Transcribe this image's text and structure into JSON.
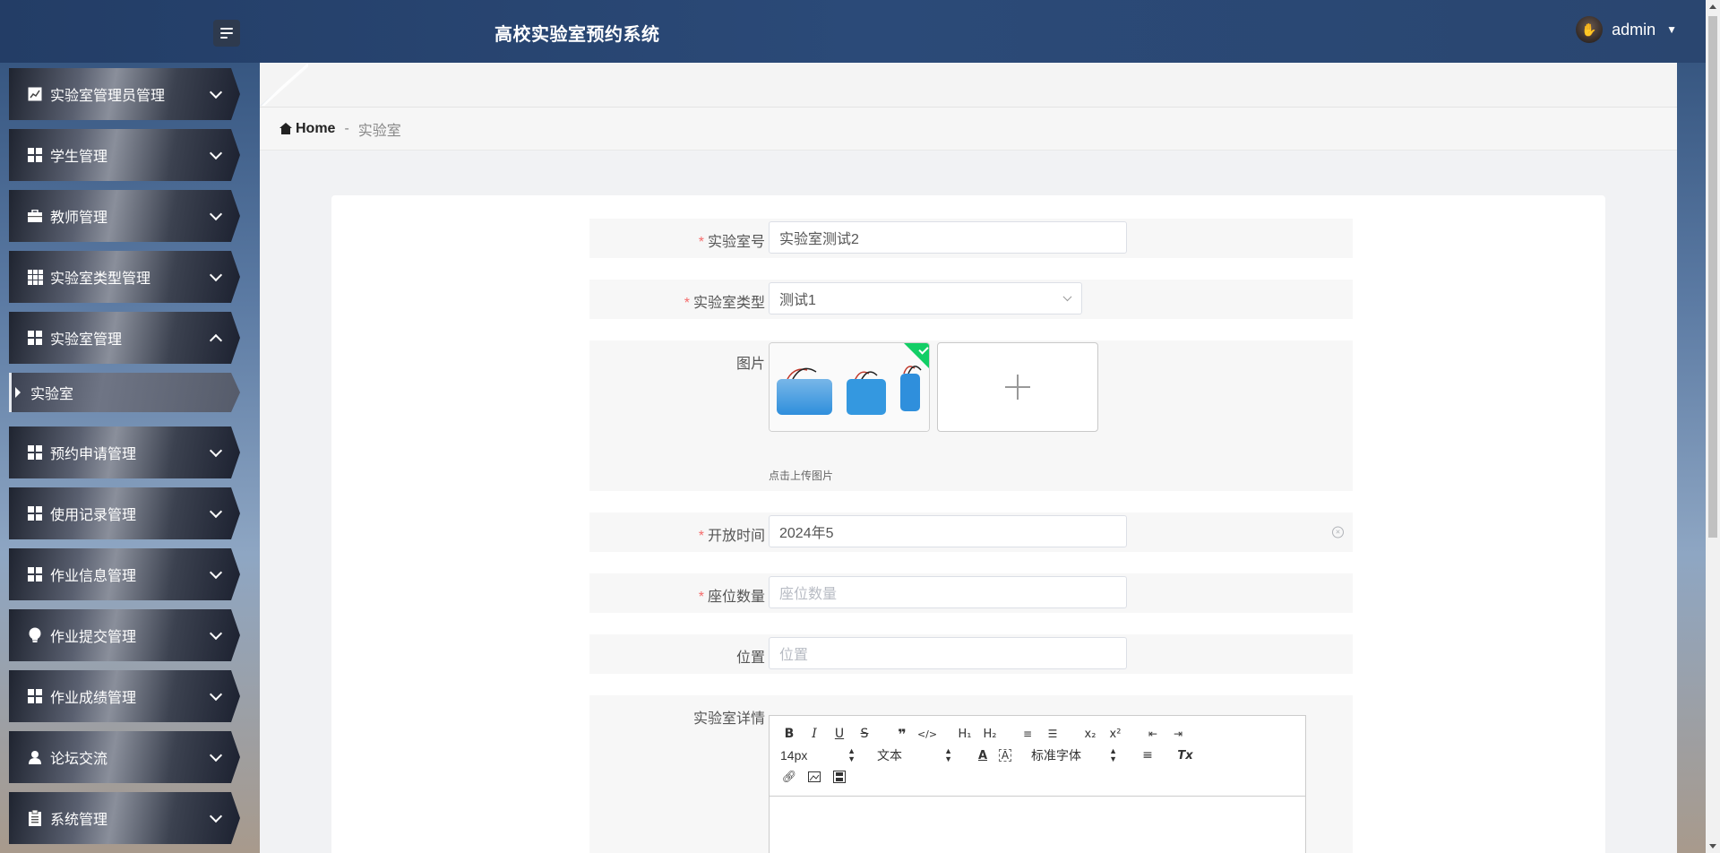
{
  "header": {
    "title": "高校实验室预约系统",
    "username": "admin"
  },
  "sidebar": {
    "items": [
      {
        "label": "实验室管理员管理",
        "icon": "chart-line-icon"
      },
      {
        "label": "学生管理",
        "icon": "grid-icon"
      },
      {
        "label": "教师管理",
        "icon": "briefcase-icon"
      },
      {
        "label": "实验室类型管理",
        "icon": "grid9-icon"
      },
      {
        "label": "实验室管理",
        "icon": "grid-icon",
        "expanded": true
      },
      {
        "label": "预约申请管理",
        "icon": "grid-icon"
      },
      {
        "label": "使用记录管理",
        "icon": "grid-icon"
      },
      {
        "label": "作业信息管理",
        "icon": "grid-icon"
      },
      {
        "label": "作业提交管理",
        "icon": "lightbulb-icon"
      },
      {
        "label": "作业成绩管理",
        "icon": "grid-icon"
      },
      {
        "label": "论坛交流",
        "icon": "user-icon"
      },
      {
        "label": "系统管理",
        "icon": "clipboard-icon"
      }
    ],
    "sub_item": "实验室"
  },
  "breadcrumb": {
    "home": "Home",
    "separator": "-",
    "current": "实验室"
  },
  "form": {
    "lab_no": {
      "label": "实验室号",
      "value": "实验室测试2"
    },
    "lab_type": {
      "label": "实验室类型",
      "value": "测试1"
    },
    "image": {
      "label": "图片",
      "tip": "点击上传图片"
    },
    "open_time": {
      "label": "开放时间",
      "value": "2024年5"
    },
    "seats": {
      "label": "座位数量",
      "placeholder": "座位数量"
    },
    "location": {
      "label": "位置",
      "placeholder": "位置"
    },
    "details": {
      "label": "实验室详情"
    }
  },
  "editor": {
    "font_size": "14px",
    "text_type": "文本",
    "font_family": "标准字体"
  },
  "colors": {
    "header_bg": "#233d66",
    "required": "#f56c6c",
    "upload_success": "#13ce66"
  }
}
